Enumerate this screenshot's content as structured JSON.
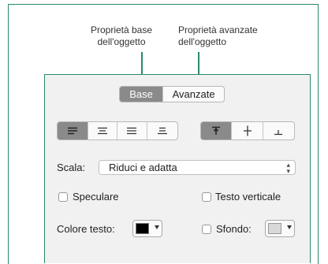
{
  "callouts": {
    "base_line1": "Proprietà base",
    "base_line2": "dell'oggetto",
    "advanced_line1": "Proprietà avanzate",
    "advanced_line2": "dell'oggetto"
  },
  "tabs": [
    {
      "label": "Base",
      "selected": true
    },
    {
      "label": "Avanzate",
      "selected": false
    }
  ],
  "alignment": {
    "horizontal": [
      "align-left-icon",
      "align-center-icon",
      "align-right-icon",
      "align-justify-icon"
    ],
    "horizontal_selected": "align-left-icon",
    "vertical": [
      "align-top-icon",
      "align-middle-icon",
      "align-bottom-icon"
    ],
    "vertical_selected": "align-top-icon"
  },
  "scale": {
    "label": "Scala:",
    "value": "Riduci e adatta"
  },
  "options": {
    "mirror_label": "Speculare",
    "mirror_checked": false,
    "vertical_text_label": "Testo verticale",
    "vertical_text_checked": false
  },
  "text_color": {
    "label": "Colore testo:",
    "color": "#000000"
  },
  "background": {
    "label": "Sfondo:",
    "checked": false,
    "color": "#d8d8d8"
  },
  "colors": {
    "accent": "#2a8a6a",
    "segment_selected": "#8a8a8a"
  }
}
